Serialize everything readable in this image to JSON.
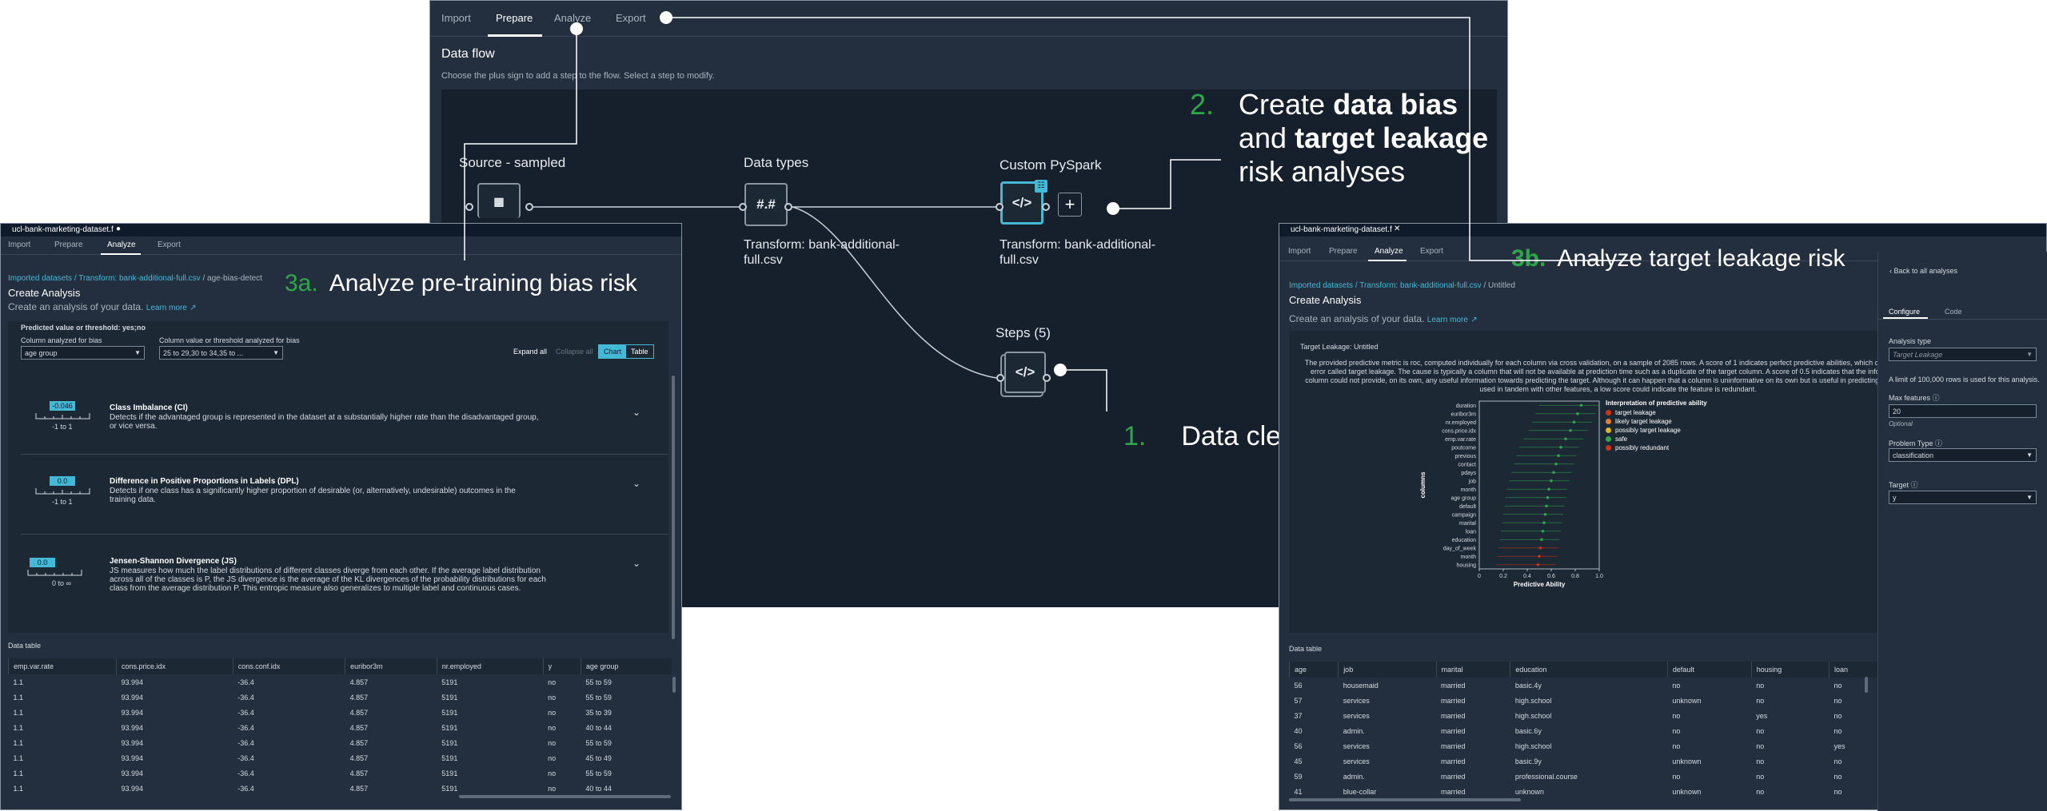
{
  "flow": {
    "tabs": [
      "Import",
      "Prepare",
      "Analyze",
      "Export"
    ],
    "active_tab": "Prepare",
    "title": "Data flow",
    "subtitle": "Choose the plus sign to add a step to the flow. Select a step to modify.",
    "nodes": {
      "source_label": "Source - sampled",
      "datatypes_label": "Data types",
      "datatypes_icon": "#.#",
      "datatypes_sub": "Transform: bank-additional-full.csv",
      "pyspark_label": "Custom PySpark",
      "pyspark_sub": "Transform: bank-additional-full.csv",
      "steps_label": "Steps (5)"
    }
  },
  "annotations": {
    "a1_num": "1.",
    "a1_text": "Data cleansing steps",
    "a2_num": "2.",
    "a2_line1a": "Create ",
    "a2_line1b": "data bias",
    "a2_line2a": "and ",
    "a2_line2b": "target leakage",
    "a2_line3": "risk analyses",
    "a3a_num": "3a.",
    "a3a_text": "Analyze pre-training bias risk",
    "a3b_num": "3b.",
    "a3b_text": "Analyze target leakage risk"
  },
  "bias": {
    "window_title": "ucl-bank-marketing-dataset.f",
    "tabs": [
      "Import",
      "Prepare",
      "Analyze",
      "Export"
    ],
    "active_tab": "Analyze",
    "crumb_1": "Imported datasets",
    "crumb_2": "Transform: bank-additional-full.csv",
    "crumb_3": "age-bias-detect",
    "title": "Create Analysis",
    "subtitle": "Create an analysis of your data.",
    "learn_more": "Learn more",
    "predicted_value": "Predicted value or threshold: yes;no",
    "col_label": "Column analyzed for bias",
    "col_value": "age group",
    "val_label": "Column value or threshold analyzed for bias",
    "val_value": "25 to 29,30 to 34,35 to ...",
    "expand_all": "Expand all",
    "collapse_all": "Collapse all",
    "chart": "Chart",
    "table": "Table",
    "metrics": [
      {
        "value": "-0.046",
        "range": "-1 to 1",
        "title": "Class Imbalance (CI)",
        "desc": "Detects if the advantaged group is represented in the dataset at a substantially higher rate than the disadvantaged group, or vice versa."
      },
      {
        "value": "0.0",
        "range": "-1 to 1",
        "title": "Difference in Positive Proportions in Labels (DPL)",
        "desc": "Detects if one class has a significantly higher proportion of desirable (or, alternatively, undesirable) outcomes in the training data."
      },
      {
        "value": "0.0",
        "range": "0 to ∞",
        "title": "Jensen-Shannon Divergence (JS)",
        "desc": "JS measures how much the label distributions of different classes diverge from each other. If the average label distribution across all of the classes is P, the JS divergence is the average of the KL divergences of the probability distributions for each class from the average distribution P. This entropic measure also generalizes to multiple label and continuous cases."
      }
    ],
    "metric_values": [
      -0.046,
      0.0,
      0.0
    ],
    "data_table_label": "Data table",
    "columns": [
      "emp.var.rate",
      "cons.price.idx",
      "cons.conf.idx",
      "euribor3m",
      "nr.employed",
      "y",
      "age group"
    ],
    "rows": [
      [
        "1.1",
        "93.994",
        "-36.4",
        "4.857",
        "5191",
        "no",
        "55 to 59"
      ],
      [
        "1.1",
        "93.994",
        "-36.4",
        "4.857",
        "5191",
        "no",
        "55 to 59"
      ],
      [
        "1.1",
        "93.994",
        "-36.4",
        "4.857",
        "5191",
        "no",
        "35 to 39"
      ],
      [
        "1.1",
        "93.994",
        "-36.4",
        "4.857",
        "5191",
        "no",
        "40 to 44"
      ],
      [
        "1.1",
        "93.994",
        "-36.4",
        "4.857",
        "5191",
        "no",
        "55 to 59"
      ],
      [
        "1.1",
        "93.994",
        "-36.4",
        "4.857",
        "5191",
        "no",
        "45 to 49"
      ],
      [
        "1.1",
        "93.994",
        "-36.4",
        "4.857",
        "5191",
        "no",
        "55 to 59"
      ],
      [
        "1.1",
        "93.994",
        "-36.4",
        "4.857",
        "5191",
        "no",
        "40 to 44"
      ]
    ]
  },
  "leak": {
    "window_title": "ucl-bank-marketing-dataset.f",
    "tabs": [
      "Import",
      "Prepare",
      "Analyze",
      "Export"
    ],
    "active_tab": "Analyze",
    "crumb_1": "Imported datasets",
    "crumb_2": "Transform: bank-additional-full.csv",
    "crumb_3": "Untitled",
    "title": "Create Analysis",
    "subtitle": "Create an analysis of your data.",
    "learn_more": "Learn more",
    "panel_title": "Target Leakage: Untitled",
    "description": "The provided predictive metric is roc, computed individually for each column via cross validation, on a sample of 2085 rows. A score of 1 indicates perfect predictive abilities, which often indicates an error called target leakage. The cause is typically a column that will not be available at prediction time such as a duplicate of the target column. A score of 0.5 indicates that the information on the column could not provide, on its own, any useful information towards predicting the target. Although it can happen that a column is uninformative on its own but is useful in predicting the target when used in tandem with other features, a low score could indicate the feature is redundant.",
    "data_table_label": "Data table",
    "columns": [
      "age",
      "job",
      "marital",
      "education",
      "default",
      "housing",
      "loan"
    ],
    "rows": [
      [
        "56",
        "housemaid",
        "married",
        "basic.4y",
        "no",
        "no",
        "no"
      ],
      [
        "57",
        "services",
        "married",
        "high.school",
        "unknown",
        "no",
        "no"
      ],
      [
        "37",
        "services",
        "married",
        "high.school",
        "no",
        "yes",
        "no"
      ],
      [
        "40",
        "admin.",
        "married",
        "basic.6y",
        "no",
        "no",
        "no"
      ],
      [
        "56",
        "services",
        "married",
        "high.school",
        "no",
        "no",
        "yes"
      ],
      [
        "45",
        "services",
        "married",
        "basic.9y",
        "unknown",
        "no",
        "no"
      ],
      [
        "59",
        "admin.",
        "married",
        "professional.course",
        "no",
        "no",
        "no"
      ],
      [
        "41",
        "blue-collar",
        "married",
        "unknown",
        "unknown",
        "no",
        "no"
      ]
    ],
    "side": {
      "back": "Back to all analyses",
      "tab_configure": "Configure",
      "tab_code": "Code",
      "analysis_type_label": "Analysis type",
      "analysis_type_value": "Target Leakage",
      "limit_note": "A limit of 100,000 rows is used for this analysis.",
      "max_features_label": "Max features",
      "max_features_value": "20",
      "optional": "Optional",
      "problem_type_label": "Problem Type",
      "problem_type_value": "classification",
      "target_label": "Target",
      "target_value": "y"
    }
  },
  "chart_data": {
    "type": "scatter",
    "categories": [
      "duration",
      "euribor3m",
      "nr.employed",
      "cons.price.idx",
      "emp.var.rate",
      "poutcome",
      "previous",
      "contact",
      "pdays",
      "job",
      "month",
      "age group",
      "default",
      "campaign",
      "marital",
      "loan",
      "education",
      "day_of_week",
      "month",
      "housing"
    ],
    "values": [
      0.85,
      0.82,
      0.79,
      0.76,
      0.72,
      0.68,
      0.66,
      0.64,
      0.62,
      0.6,
      0.58,
      0.57,
      0.56,
      0.55,
      0.54,
      0.53,
      0.52,
      0.51,
      0.5,
      0.49
    ],
    "colors": [
      "#2ea64a",
      "#2ea64a",
      "#2ea64a",
      "#2ea64a",
      "#2ea64a",
      "#2ea64a",
      "#2ea64a",
      "#2ea64a",
      "#2ea64a",
      "#2ea64a",
      "#2ea64a",
      "#2ea64a",
      "#2ea64a",
      "#2ea64a",
      "#2ea64a",
      "#2ea64a",
      "#2ea64a",
      "#d13212",
      "#d13212",
      "#d13212"
    ],
    "xlabel": "Predictive Ability",
    "ylabel": "columns",
    "xlim": [
      0,
      1
    ],
    "xticks": [
      "0",
      "0.2",
      "0.4",
      "0.6",
      "0.8",
      "1.0"
    ],
    "legend_title": "Interpretation of predictive ability",
    "legend": [
      {
        "label": "target leakage",
        "color": "#d13212"
      },
      {
        "label": "likely target leakage",
        "color": "#e07b39"
      },
      {
        "label": "possibly target leakage",
        "color": "#dfb52c"
      },
      {
        "label": "safe",
        "color": "#2ea64a"
      },
      {
        "label": "possibly redundant",
        "color": "#d13212"
      }
    ]
  }
}
